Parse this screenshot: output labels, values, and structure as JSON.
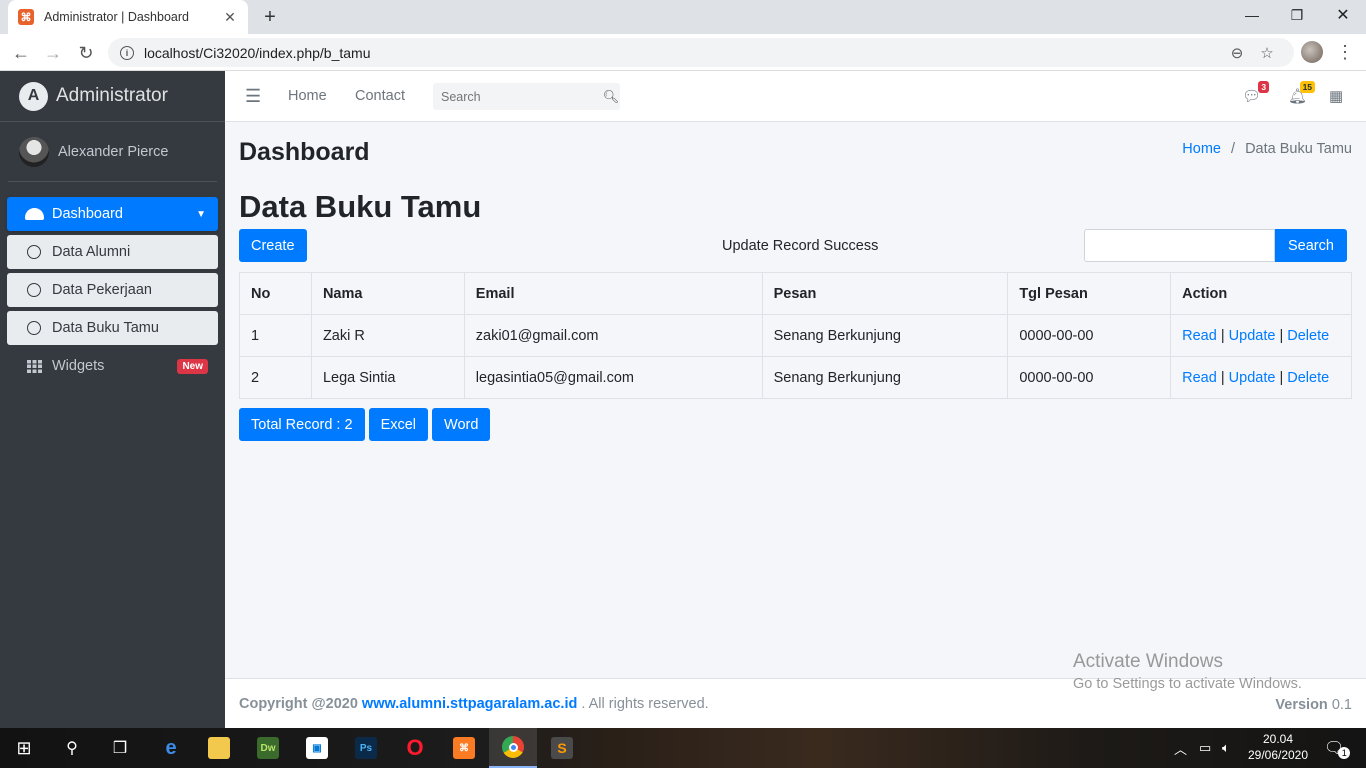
{
  "browser": {
    "tab_title": "Administrator | Dashboard",
    "url": "localhost/Ci32020/index.php/b_tamu"
  },
  "sidebar": {
    "brand": "Administrator",
    "user_name": "Alexander Pierce",
    "items": [
      {
        "label": "Dashboard"
      },
      {
        "label": "Data Alumni"
      },
      {
        "label": "Data Pekerjaan"
      },
      {
        "label": "Data Buku Tamu"
      },
      {
        "label": "Widgets",
        "badge": "New"
      }
    ]
  },
  "topnav": {
    "links": [
      "Home",
      "Contact"
    ],
    "search_placeholder": "Search",
    "messages_count": "3",
    "notifications_count": "15"
  },
  "content": {
    "page_title": "Dashboard",
    "breadcrumb": {
      "home": "Home",
      "separator": "/",
      "current": "Data Buku Tamu"
    },
    "section_title": "Data Buku Tamu",
    "create_label": "Create",
    "message": "Update Record Success",
    "search_label": "Search",
    "search_value": "",
    "table": {
      "headers": [
        "No",
        "Nama",
        "Email",
        "Pesan",
        "Tgl Pesan",
        "Action"
      ],
      "rows": [
        {
          "no": "1",
          "nama": "Zaki R",
          "email": "zaki01@gmail.com",
          "pesan": "Senang Berkunjung",
          "tgl": "0000-00-00"
        },
        {
          "no": "2",
          "nama": "Lega Sintia",
          "email": "legasintia05@gmail.com",
          "pesan": "Senang Berkunjung",
          "tgl": "0000-00-00"
        }
      ],
      "actions": {
        "read": "Read",
        "update": "Update",
        "delete": "Delete",
        "sep": "|"
      }
    },
    "total_label": "Total Record : 2",
    "excel_label": "Excel",
    "word_label": "Word"
  },
  "footer": {
    "copyright_prefix": "Copyright @2020",
    "site_link": "www.alumni.sttpagaralam.ac.id",
    "suffix": ". All rights reserved.",
    "version_label": "Version",
    "version": "0.1"
  },
  "watermark": {
    "line1": "Activate Windows",
    "line2": "Go to Settings to activate Windows."
  },
  "taskbar": {
    "time": "20.04",
    "date": "29/06/2020",
    "notif_count": "1"
  },
  "colors": {
    "primary": "#007bff",
    "sidebar_bg": "#343a40",
    "danger": "#dc3545",
    "warning": "#ffc107"
  }
}
